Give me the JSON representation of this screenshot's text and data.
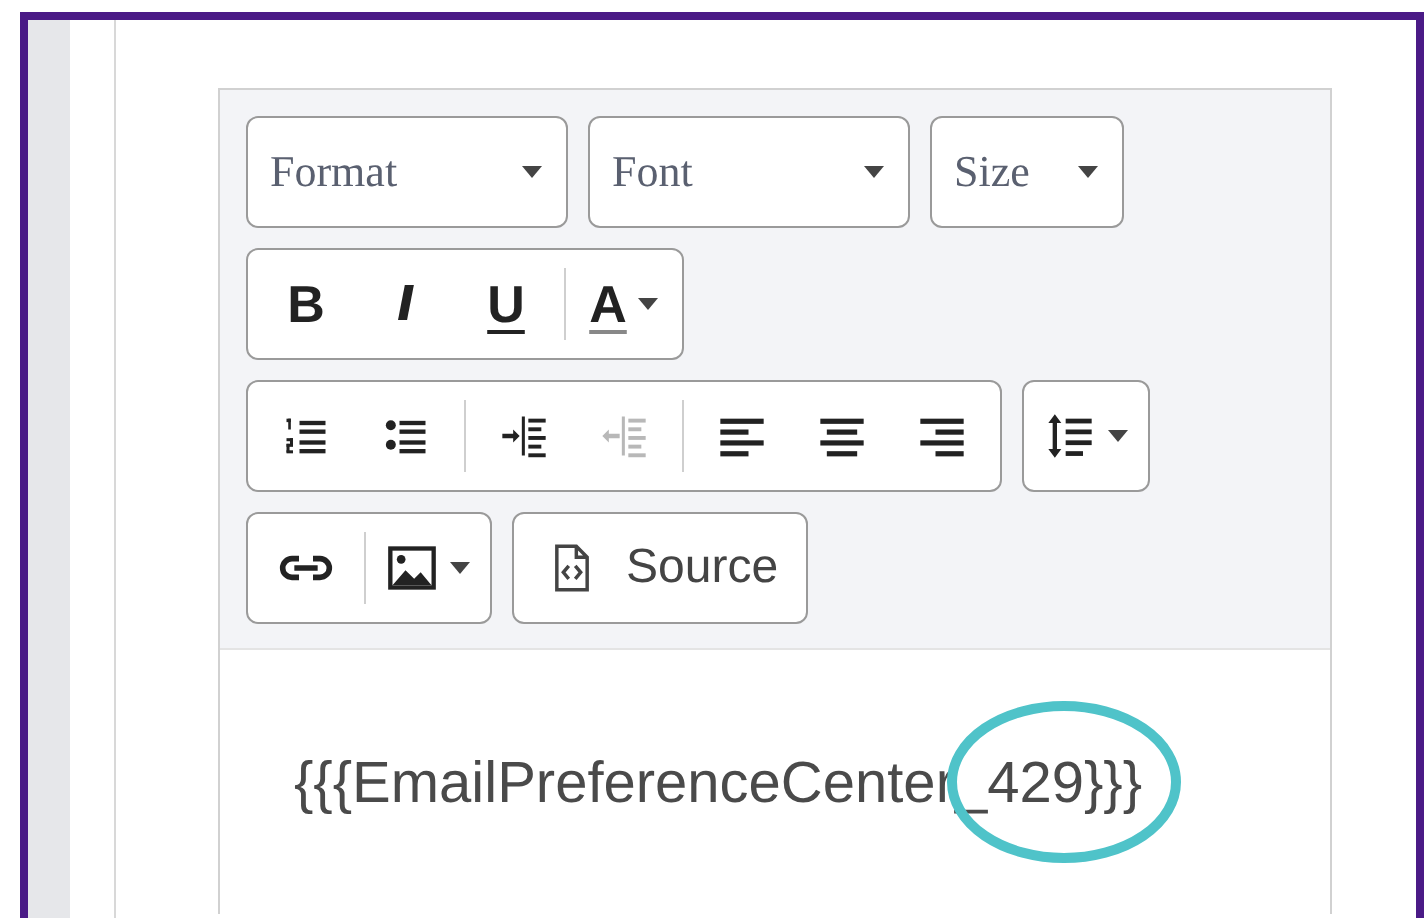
{
  "toolbar": {
    "rows": [
      {
        "items": [
          {
            "kind": "select",
            "label": "Format"
          },
          {
            "kind": "select",
            "label": "Font"
          },
          {
            "kind": "select",
            "label": "Size"
          }
        ]
      },
      {
        "items": [
          {
            "kind": "group",
            "sections": [
              [
                {
                  "kind": "bold",
                  "label": "B",
                  "dropdown": false,
                  "disabled": false
                },
                {
                  "kind": "italic",
                  "label": "I",
                  "dropdown": false,
                  "disabled": false
                },
                {
                  "kind": "underline",
                  "label": "U",
                  "dropdown": false,
                  "disabled": false
                }
              ],
              [
                {
                  "kind": "color",
                  "label": "A",
                  "dropdown": true,
                  "disabled": false
                }
              ]
            ]
          }
        ]
      },
      {
        "items": [
          {
            "kind": "group",
            "sections": [
              [
                {
                  "kind": "numbered",
                  "dropdown": false,
                  "disabled": false
                },
                {
                  "kind": "bulleted",
                  "dropdown": false,
                  "disabled": false
                }
              ],
              [
                {
                  "kind": "indent",
                  "dropdown": false,
                  "disabled": false
                },
                {
                  "kind": "outdent",
                  "dropdown": false,
                  "disabled": true
                }
              ],
              [
                {
                  "kind": "left",
                  "dropdown": false,
                  "disabled": false
                },
                {
                  "kind": "center",
                  "dropdown": false,
                  "disabled": false
                },
                {
                  "kind": "right",
                  "dropdown": false,
                  "disabled": false
                }
              ]
            ]
          },
          {
            "kind": "group",
            "sections": [
              [
                {
                  "kind": "spacing",
                  "dropdown": true,
                  "disabled": false
                }
              ]
            ]
          }
        ]
      },
      {
        "items": [
          {
            "kind": "group",
            "sections": [
              [
                {
                  "kind": "link",
                  "dropdown": false,
                  "disabled": false
                }
              ],
              [
                {
                  "kind": "image",
                  "dropdown": true,
                  "disabled": false
                }
              ]
            ]
          },
          {
            "kind": "button",
            "label": "Source"
          }
        ]
      }
    ]
  },
  "content": {
    "text": "{{{EmailPreferenceCenter_429}}}"
  },
  "annotation": {
    "kind": "ellipse"
  }
}
